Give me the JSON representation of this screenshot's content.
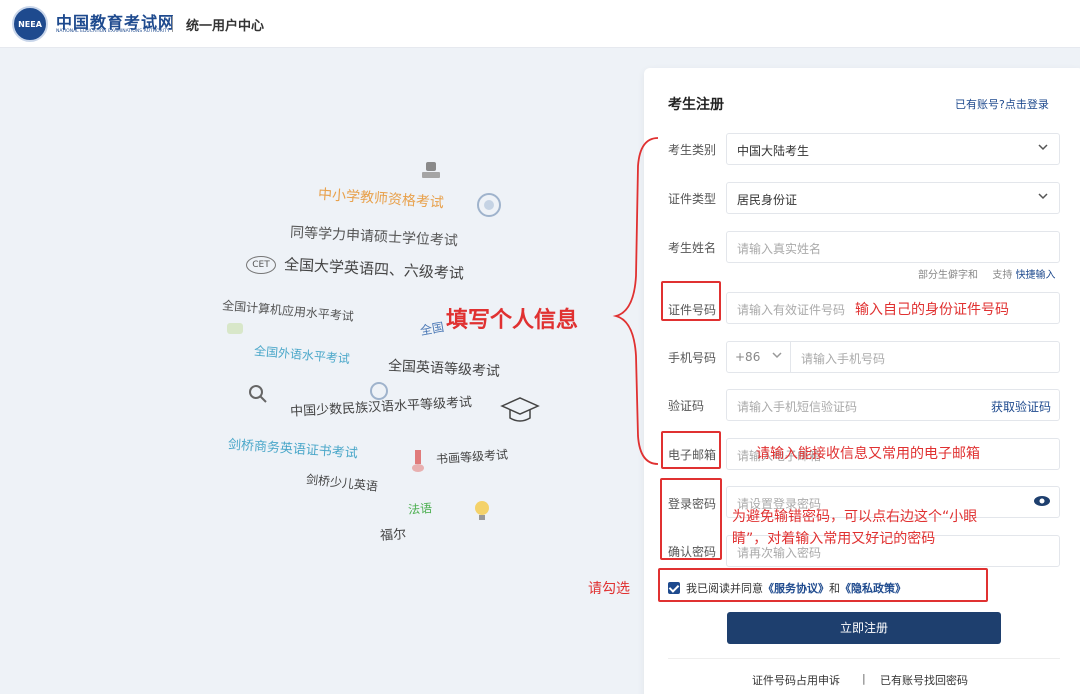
{
  "header": {
    "logo_emblem": "NEEA",
    "logo_cn": "中国教育考试网",
    "logo_en": "NATIONAL EDUCATION EXAMINATIONS AUTHORITY",
    "subtitle": "统一用户中心"
  },
  "background_words": [
    "中小学教师资格考试",
    "同等学力申请硕士学位考试",
    "全国大学英语四、六级考试",
    "全国计算机应用水平考试",
    "全国外语水平考试",
    "全国英语等级考试",
    "中国少数民族汉语水平等级考试",
    "剑桥商务英语证书考试",
    "书画等级考试",
    "剑桥少儿英语",
    "法语",
    "福尔",
    "全国"
  ],
  "background_icons": {
    "cet": "CET"
  },
  "form": {
    "title": "考生注册",
    "login_link": "已有账号?点击登录",
    "category_label": "考生类别",
    "category_value": "中国大陆考生",
    "id_type_label": "证件类型",
    "id_type_value": "居民身份证",
    "name_label": "考生姓名",
    "name_placeholder": "请输入真实姓名",
    "rare_char_hint": "部分生僻字和",
    "rare_char_hint2": "支持",
    "quick_input": "快捷输入",
    "id_label": "证件号码",
    "id_placeholder": "请输入有效证件号码",
    "phone_label": "手机号码",
    "phone_prefix": "+86",
    "phone_placeholder": "请输入手机号码",
    "code_label": "验证码",
    "code_placeholder": "请输入手机短信验证码",
    "get_code": "获取验证码",
    "email_label": "电子邮箱",
    "email_placeholder": "请输入电子邮箱",
    "password_label": "登录密码",
    "password_placeholder": "请设置登录密码",
    "confirm_label": "确认密码",
    "confirm_placeholder": "请再次输入密码",
    "agree_prefix": "我已阅读并同意",
    "service_agreement": "《服务协议》",
    "agree_and": "和",
    "privacy_policy": "《隐私政策》",
    "submit": "立即注册",
    "footer_left": "证件号码占用申诉",
    "footer_sep": "|",
    "footer_right": "已有账号找回密码"
  },
  "annotations": {
    "fill_info": "填写个人信息",
    "id_hint": "输入自己的身份证件号码",
    "email_hint": "请输入能接收信息又常用的电子邮箱",
    "password_hint_1": "为避免输错密码，可以点右边这个“小眼",
    "password_hint_2": "睛”，对着输入常用又好记的密码",
    "check_hint": "请勾选"
  },
  "colors": {
    "brand": "#1e4a8e",
    "annotation": "#e03131",
    "button": "#1e3f6e"
  }
}
